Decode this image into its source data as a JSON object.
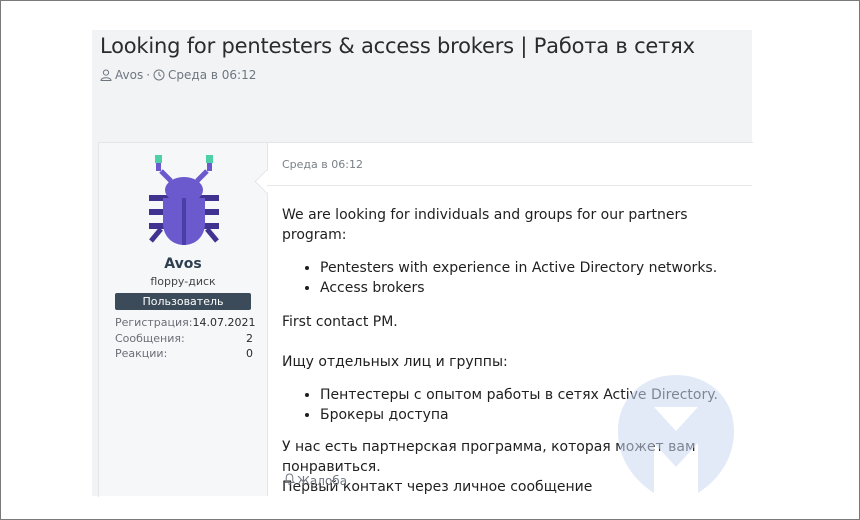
{
  "thread": {
    "title": "Looking for pentesters & access brokers | Работа в сетях",
    "author": "Avos",
    "posted": "Среда в 06:12"
  },
  "user": {
    "name": "Avos",
    "title": "floppy-диск",
    "banner": "Пользователь",
    "stats": [
      {
        "label": "Регистрация:",
        "value": "14.07.2021"
      },
      {
        "label": "Сообщения:",
        "value": "2"
      },
      {
        "label": "Реакции:",
        "value": "0"
      }
    ]
  },
  "post": {
    "date": "Среда в 06:12",
    "en_intro": "We are looking for individuals and groups for our partners program:",
    "en_items": [
      "Pentesters with experience in Active Directory networks.",
      "Access brokers"
    ],
    "en_contact": "First contact PM.",
    "ru_intro": "Ищу отдельных лиц и группы:",
    "ru_items": [
      "Пентестеры с опытом работы в сетях Active Directory.",
      "Брокеры доступа"
    ],
    "ru_line1": "У нас есть партнерская программа, которая может вам понравиться.",
    "ru_line2": "Первый контакт через личное сообщение",
    "report": "Жалоба"
  },
  "colors": {
    "avatar_bug": "#6a5acd",
    "avatar_legs": "#3f3290",
    "antenna_tips": "#4dd0a4",
    "banner": "#3c4b5a",
    "watermark": "#cbd8f2"
  },
  "icons": [
    "user-icon",
    "clock-icon",
    "bug-avatar-icon",
    "bell-icon",
    "malwarebytes-logo-icon"
  ]
}
